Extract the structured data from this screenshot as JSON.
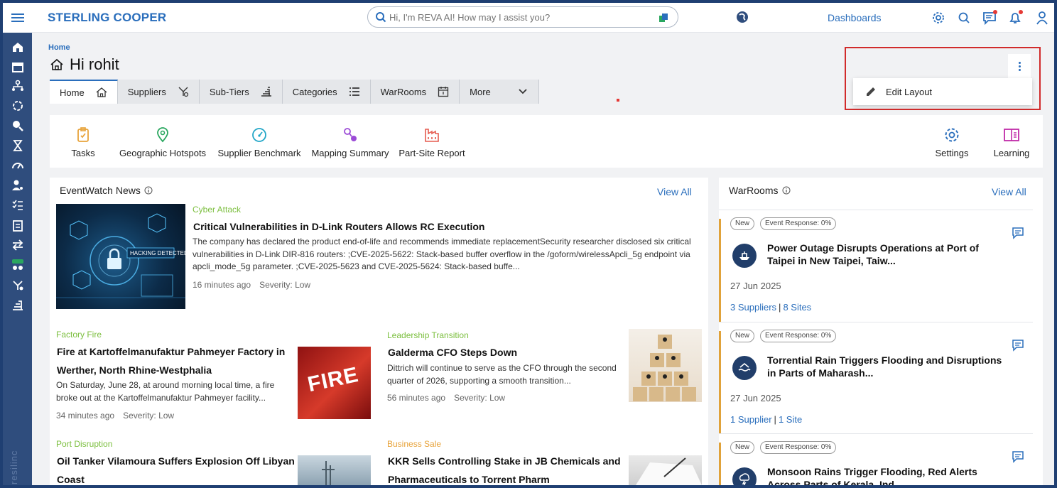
{
  "header": {
    "brand": "STERLING COOPER",
    "search_placeholder": "Hi, I'm REVA AI! How may I assist you?",
    "dashboards_label": "Dashboards"
  },
  "rail": {
    "brand_text": "resilinc"
  },
  "page": {
    "breadcrumb": "Home",
    "greeting": "Hi rohit"
  },
  "tabs": [
    {
      "label": "Home",
      "icon": "home-icon"
    },
    {
      "label": "Suppliers",
      "icon": "suppliers-icon"
    },
    {
      "label": "Sub-Tiers",
      "icon": "sub-tiers-icon"
    },
    {
      "label": "Categories",
      "icon": "list-icon"
    },
    {
      "label": "WarRooms",
      "icon": "calendar-icon"
    },
    {
      "label": "More",
      "icon": "chevron-down-icon"
    }
  ],
  "menu": {
    "edit_layout": "Edit Layout"
  },
  "quick_links": [
    {
      "label": "Tasks",
      "icon": "clipboard-icon",
      "color": "#e8a33a"
    },
    {
      "label": "Geographic Hotspots",
      "icon": "map-pin-icon",
      "color": "#2aa75f"
    },
    {
      "label": "Supplier Benchmark",
      "icon": "gauge-icon",
      "color": "#22a6c7"
    },
    {
      "label": "Mapping Summary",
      "icon": "mapping-icon",
      "color": "#9b4bd6"
    },
    {
      "label": "Part-Site Report",
      "icon": "factory-icon",
      "color": "#e55a4e"
    },
    {
      "label": "Settings",
      "icon": "gear-icon",
      "color": "#2a6ebc"
    },
    {
      "label": "Learning",
      "icon": "book-icon",
      "color": "#c02aa8"
    }
  ],
  "eventwatch": {
    "title": "EventWatch News",
    "view_all": "View All",
    "featured": {
      "category": "Cyber Attack",
      "headline": "Critical Vulnerabilities in D-Link Routers Allows RC Execution",
      "body": "The company has declared the product end-of-life and recommends immediate replacementSecurity researcher disclosed six critical vulnerabilities in D-Link DIR-816 routers: ;CVE-2025-5622: Stack-based buffer overflow in the /goform/wirelessApcli_5g endpoint via apcli_mode_5g parameter. ;CVE-2025-5623 and CVE-2025-5624: Stack-based buffe...",
      "time": "16 minutes ago",
      "severity": "Severity: Low",
      "image_text": "HACKING DETECTED"
    },
    "items": [
      {
        "category": "Factory Fire",
        "headline": "Fire at Kartoffelmanufaktur Pahmeyer Factory in Werther, North Rhine-Westphalia",
        "body": "On Saturday, June 28, at around morning local time, a fire broke out at the Kartoffelmanufaktur Pahmeyer facility...",
        "time": "34 minutes ago",
        "severity": "Severity: Low",
        "image_text": "FIRE"
      },
      {
        "category": "Leadership Transition",
        "headline": "Galderma CFO Steps Down",
        "body": "Dittrich will continue to serve as the CFO through the second quarter of 2026, supporting a smooth transition...",
        "time": "56 minutes ago",
        "severity": "Severity: Low"
      },
      {
        "category": "Port Disruption",
        "headline": "Oil Tanker Vilamoura Suffers Explosion Off Libyan Coast"
      },
      {
        "category": "Business Sale",
        "headline": "KKR Sells Controlling Stake in JB Chemicals and Pharmaceuticals to Torrent Pharm"
      }
    ]
  },
  "warrooms": {
    "title": "WarRooms",
    "view_all": "View All",
    "items": [
      {
        "badge_new": "New",
        "badge_response": "Event Response: 0%",
        "title": "Power Outage Disrupts Operations at Port of Taipei in New Taipei, Taiw...",
        "date": "27 Jun 2025",
        "suppliers": "3 Suppliers",
        "sites": "8 Sites",
        "icon": "ship-icon"
      },
      {
        "badge_new": "New",
        "badge_response": "Event Response: 0%",
        "title": "Torrential Rain Triggers Flooding and Disruptions in Parts of Maharash...",
        "date": "27 Jun 2025",
        "suppliers": "1 Supplier",
        "sites": "1 Site",
        "icon": "flood-icon"
      },
      {
        "badge_new": "New",
        "badge_response": "Event Response: 0%",
        "title": "Monsoon Rains Trigger Flooding, Red Alerts Across Parts of Kerala, Ind...",
        "icon": "storm-icon"
      }
    ]
  },
  "colors": {
    "brand_blue": "#2a6ebc",
    "rail": "#2f4d7d",
    "category_green": "#7cbf3f",
    "category_orange": "#e8a33a",
    "highlight_red": "#d12b2b"
  }
}
